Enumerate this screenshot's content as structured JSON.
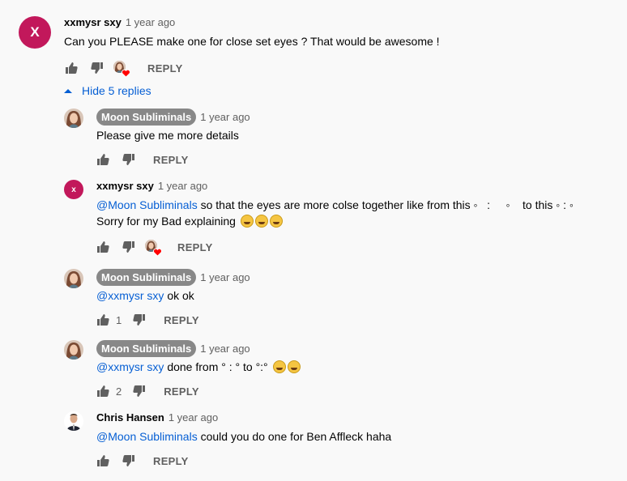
{
  "threads": {
    "top": {
      "avatar_letter": "X",
      "author": "xxmysr sxy",
      "time": "1 year ago",
      "text": "Can you PLEASE make one for close set eyes ? That would be awesome !",
      "reply_label": "REPLY"
    },
    "toggle": {
      "label": "Hide 5 replies"
    },
    "replies": [
      {
        "author": "Moon Subliminals",
        "time": "1 year ago",
        "text": "Please give me more details",
        "reply_label": "REPLY"
      },
      {
        "avatar_letter": "x",
        "author": "xxmysr sxy",
        "time": "1 year ago",
        "mention": "@Moon Subliminals",
        "text": " so that the eyes are more colse together like from this ◦   :     ◦    to this ◦ : ◦",
        "text2": "Sorry for my Bad explaining",
        "reply_label": "REPLY"
      },
      {
        "author": "Moon Subliminals",
        "time": "1 year ago",
        "mention": "@xxmysr sxy",
        "text": " ok ok",
        "likes": "1",
        "reply_label": "REPLY"
      },
      {
        "author": "Moon Subliminals",
        "time": "1 year ago",
        "mention": "@xxmysr sxy",
        "text": " done from ° : ° to °:° ",
        "likes": "2",
        "reply_label": "REPLY"
      },
      {
        "author": "Chris Hansen",
        "time": "1 year ago",
        "mention": "@Moon Subliminals",
        "text": " could you do one for Ben Affleck haha",
        "reply_label": "REPLY"
      }
    ]
  },
  "colors": {
    "link": "#065fd4",
    "secondary_text": "#606060",
    "avatar_letter_bg": "#c2185b",
    "badge_bg": "#888888",
    "heart": "#ff0000"
  },
  "icons": [
    "thumb-up-icon",
    "thumb-down-icon",
    "creator-heart-icon",
    "caret-up-icon",
    "grinning-squint-emoji"
  ]
}
